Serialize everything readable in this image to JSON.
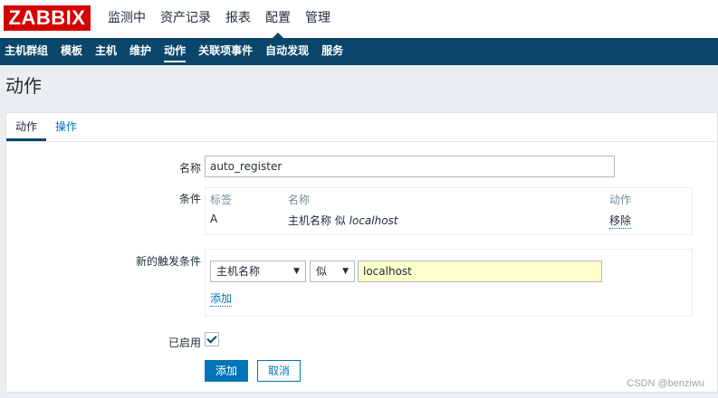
{
  "app": {
    "logo": "ZABBIX"
  },
  "main_nav": {
    "items": [
      "监测中",
      "资产记录",
      "报表",
      "配置",
      "管理"
    ],
    "active_index": 3
  },
  "sub_nav": {
    "items": [
      "主机群组",
      "模板",
      "主机",
      "维护",
      "动作",
      "关联项事件",
      "自动发现",
      "服务"
    ],
    "active_index": 4
  },
  "page": {
    "title": "动作"
  },
  "tabs": [
    "动作",
    "操作"
  ],
  "form": {
    "name_label": "名称",
    "name_value": "auto_register",
    "conditions_label": "条件",
    "conditions_table": {
      "headers": [
        "标签",
        "名称",
        "动作"
      ],
      "rows": [
        {
          "tag": "A",
          "text": "主机名称 似 ",
          "value": "localhost",
          "action": "移除"
        }
      ]
    },
    "new_condition_label": "新的触发条件",
    "new_condition": {
      "type_selected": "主机名称",
      "operator_selected": "似",
      "value": "localhost",
      "add_link": "添加"
    },
    "enabled_label": "已启用",
    "enabled": true,
    "buttons": {
      "add": "添加",
      "cancel": "取消"
    }
  },
  "watermark": "CSDN @benziwu",
  "colors": {
    "brand_red": "#d40000",
    "nav_dark": "#0a466a",
    "link_blue": "#0275b8",
    "input_highlight": "#ffffcc"
  }
}
